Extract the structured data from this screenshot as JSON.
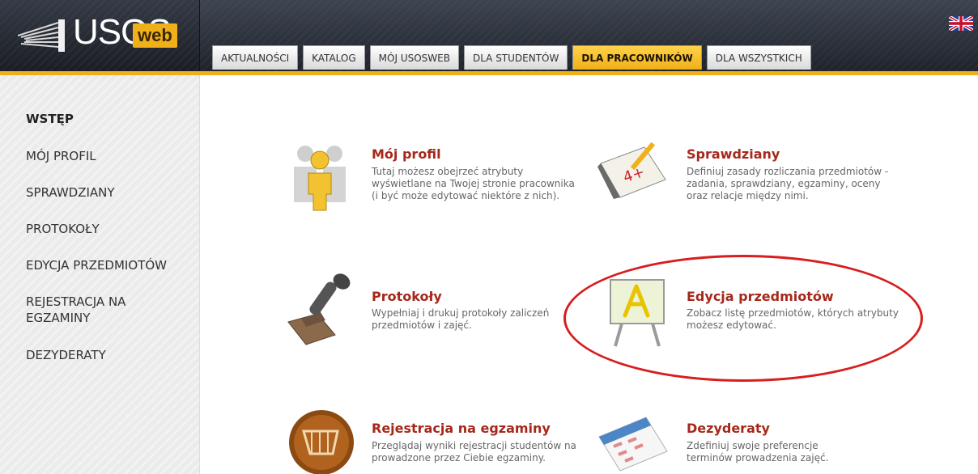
{
  "header": {
    "logo_usos": "USOS",
    "logo_web": "web",
    "language_flag": "uk-flag-icon",
    "colors": {
      "accent": "#f0b019",
      "header_bg": "#2a2e36",
      "title_red": "#a5281b",
      "highlight_circle": "#d81e1e"
    }
  },
  "tabs": [
    {
      "label": "AKTUALNOŚCI",
      "active": false
    },
    {
      "label": "KATALOG",
      "active": false
    },
    {
      "label": "MÓJ USOSWEB",
      "active": false
    },
    {
      "label": "DLA STUDENTÓW",
      "active": false
    },
    {
      "label": "DLA PRACOWNIKÓW",
      "active": true
    },
    {
      "label": "DLA WSZYSTKICH",
      "active": false
    }
  ],
  "sidebar": {
    "items": [
      {
        "label": "WSTĘP",
        "active": true
      },
      {
        "label": "MÓJ PROFIL",
        "active": false
      },
      {
        "label": "SPRAWDZIANY",
        "active": false
      },
      {
        "label": "PROTOKOŁY",
        "active": false
      },
      {
        "label": "EDYCJA PRZEDMIOTÓW",
        "active": false
      },
      {
        "label": "REJESTRACJA NA EGZAMINY",
        "active": false
      },
      {
        "label": "DEZYDERATY",
        "active": false
      }
    ]
  },
  "cards": [
    {
      "icon": "users-icon",
      "title": "Mój profil",
      "desc": [
        "Tutaj możesz obejrzeć atrybuty",
        "wyświetlane na Twojej stronie pracownika",
        "(i być może edytować niektóre z nich)."
      ]
    },
    {
      "icon": "test-paper-icon",
      "title": "Sprawdziany",
      "desc": [
        "Definiuj zasady rozliczania przedmiotów -",
        "zadania, sprawdziany, egzaminy, oceny",
        "oraz relacje między nimi."
      ]
    },
    {
      "icon": "stamp-icon",
      "title": "Protokoły",
      "desc": [
        "Wypełniaj i drukuj protokoły zaliczeń",
        "przedmiotów i zajęć."
      ]
    },
    {
      "icon": "easel-icon",
      "title": "Edycja przedmiotów",
      "desc": [
        "Zobacz listę przedmiotów, których atrybuty",
        "możesz edytować."
      ]
    },
    {
      "icon": "shopping-cart-icon",
      "title": "Rejestracja na egzaminy",
      "desc": [
        "Przeglądaj wyniki rejestracji studentów na",
        "prowadzone przez Ciebie egzaminy."
      ]
    },
    {
      "icon": "calendar-icon",
      "title": "Dezyderaty",
      "desc": [
        "Zdefiniuj swoje preferencje",
        "terminów prowadzenia zajęć."
      ]
    }
  ]
}
